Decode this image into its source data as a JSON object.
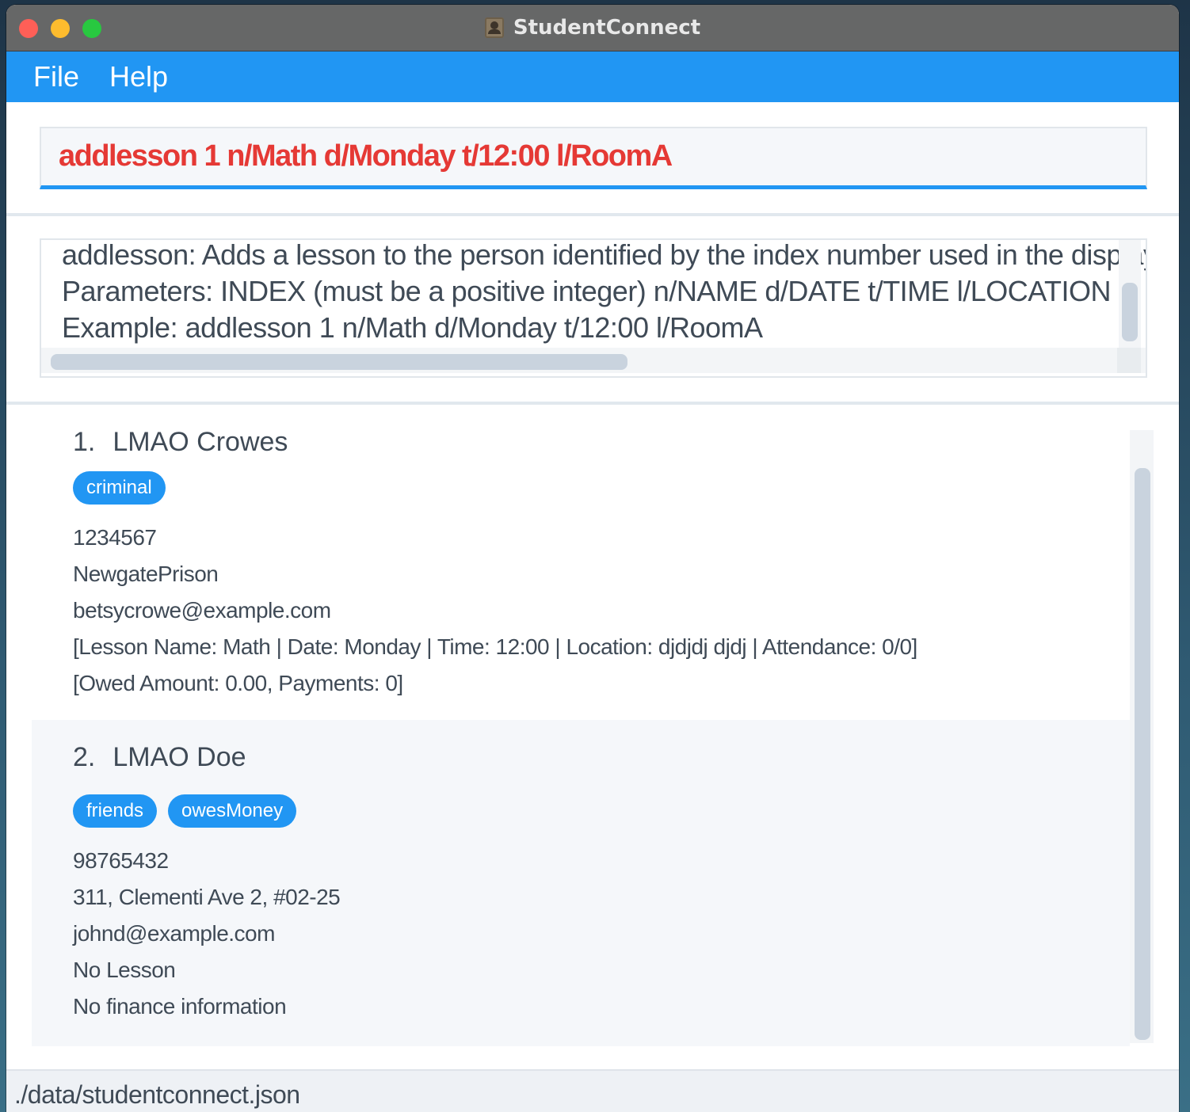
{
  "window": {
    "title": "StudentConnect"
  },
  "menu": {
    "items": [
      "File",
      "Help"
    ]
  },
  "command_box": {
    "value": "addlesson 1 n/Math d/Monday t/12:00 l/RoomA",
    "text_color": "#e53935"
  },
  "result_display": {
    "lines": [
      "addlesson: Adds a lesson to the person identified by the index number used in the displayed person list.",
      "Parameters: INDEX (must be a positive integer) n/NAME d/DATE t/TIME l/LOCATION",
      "Example: addlesson 1 n/Math d/Monday t/12:00 l/RoomA"
    ]
  },
  "persons": [
    {
      "index": "1.",
      "name": "LMAO Crowes",
      "tags": [
        "criminal"
      ],
      "phone": "1234567",
      "address": "NewgatePrison",
      "email": "betsycrowe@example.com",
      "lesson": "[Lesson Name: Math | Date: Monday | Time: 12:00 | Location: djdjdj djdj | Attendance: 0/0]",
      "finance": "[Owed Amount: 0.00, Payments: 0]"
    },
    {
      "index": "2.",
      "name": "LMAO Doe",
      "tags": [
        "friends",
        "owesMoney"
      ],
      "phone": "98765432",
      "address": "311, Clementi Ave 2, #02-25",
      "email": "johnd@example.com",
      "lesson": "No Lesson",
      "finance": "No finance information"
    }
  ],
  "status_bar": {
    "path": "./data/studentconnect.json"
  },
  "colors": {
    "accent": "#2196f3",
    "command_text": "#e53935",
    "titlebar": "#666767",
    "text": "#3f4a56"
  }
}
